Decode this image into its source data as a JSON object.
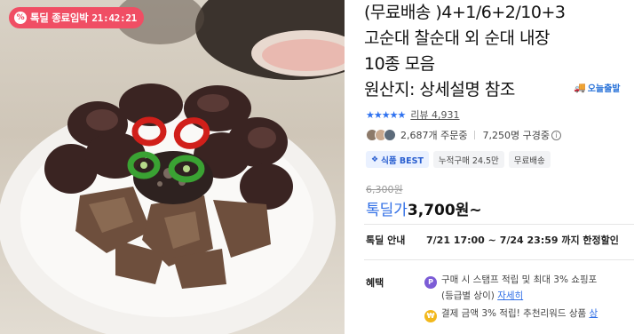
{
  "photo": {
    "alt_subject": "soondae-plate",
    "deal_badge": {
      "icon": "percent-icon",
      "label": "톡딜 종료임박",
      "timer": "21:42:21"
    }
  },
  "product": {
    "title_lines": [
      "(무료배송 )4+1/6+2/10+3",
      "고순대 찰순대 외 순대 내장",
      "10종 모음",
      "원산지: 상세설명 참조"
    ],
    "delivery_tag": "오늘출발",
    "rating_stars": "★★★★★",
    "review_text": "리뷰 4,931",
    "orders_text": "2,687개 주문중",
    "watching_text": "7,250명 구경중",
    "tags": [
      {
        "label": "식품 BEST",
        "style": "best"
      },
      {
        "label": "누적구매 24.5만",
        "style": "plain"
      },
      {
        "label": "무료배송",
        "style": "plain"
      }
    ],
    "original_price": "6,300원",
    "deal_price_label": "톡딜가",
    "deal_price": "3,700원~",
    "deal_info_label": "톡딜 안내",
    "deal_info_value": "7/21 17:00 ~ 7/24 23:59 까지 한정할인",
    "benefits_label": "혜택",
    "benefit1_line1": "구매 시 스탬프 적립 및 최대 3% 쇼핑포",
    "benefit1_line2": "(등급별 상이)",
    "benefit1_link": "자세히",
    "benefit2_text": "결제 금액 3% 적립! 추천리워드 상품",
    "benefit2_link": "상"
  },
  "colors": {
    "accent": "#2f6ee6",
    "deal_badge": "#f04e64",
    "stars": "#2f72f0"
  }
}
